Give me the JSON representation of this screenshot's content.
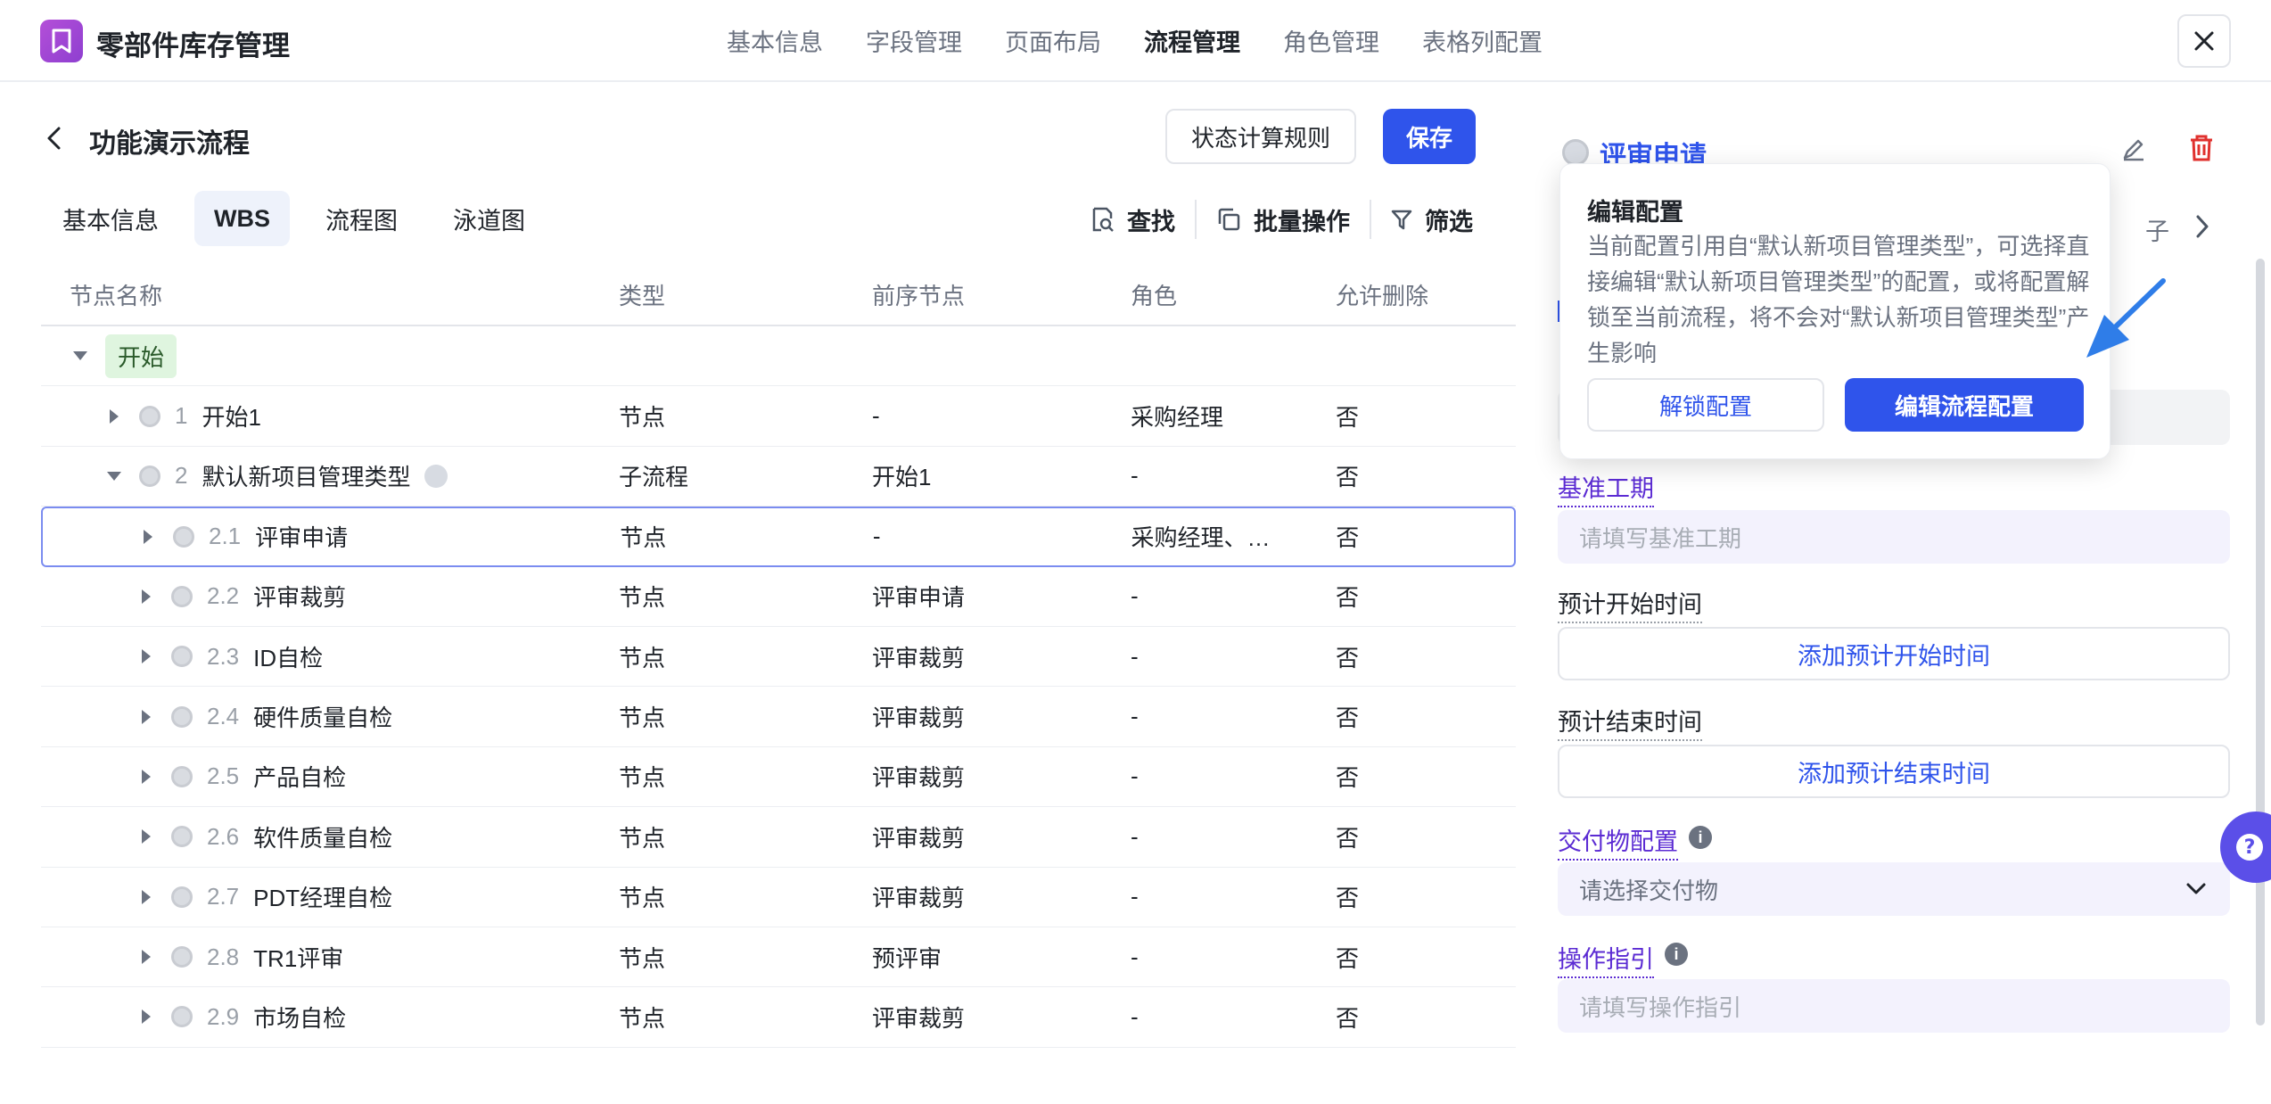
{
  "app": {
    "title": "零部件库存管理"
  },
  "top_tabs": [
    {
      "label": "基本信息",
      "active": false
    },
    {
      "label": "字段管理",
      "active": false
    },
    {
      "label": "页面布局",
      "active": false
    },
    {
      "label": "流程管理",
      "active": true
    },
    {
      "label": "角色管理",
      "active": false
    },
    {
      "label": "表格列配置",
      "active": false
    }
  ],
  "page": {
    "title": "功能演示流程",
    "rule_button": "状态计算规则",
    "save_button": "保存"
  },
  "sub_tabs": [
    {
      "label": "基本信息",
      "active": false
    },
    {
      "label": "WBS",
      "active": true
    },
    {
      "label": "流程图",
      "active": false
    },
    {
      "label": "泳道图",
      "active": false
    }
  ],
  "tools": {
    "find": "查找",
    "batch": "批量操作",
    "filter": "筛选"
  },
  "table": {
    "headers": {
      "name": "节点名称",
      "type": "类型",
      "pre": "前序节点",
      "role": "角色",
      "del": "允许删除"
    },
    "start_label": "开始",
    "rows": [
      {
        "num": "1",
        "name": "开始1",
        "type": "节点",
        "pre": "-",
        "role": "采购经理",
        "del": "否",
        "level": 1,
        "expanded": false
      },
      {
        "num": "2",
        "name": "默认新项目管理类型",
        "type": "子流程",
        "pre": "开始1",
        "role": "-",
        "del": "否",
        "level": 1,
        "expanded": true
      },
      {
        "num": "2.1",
        "name": "评审申请",
        "type": "节点",
        "pre": "-",
        "role": "采购经理、…",
        "del": "否",
        "level": 2,
        "expanded": false,
        "selected": true
      },
      {
        "num": "2.2",
        "name": "评审裁剪",
        "type": "节点",
        "pre": "评审申请",
        "role": "-",
        "del": "否",
        "level": 2,
        "expanded": false
      },
      {
        "num": "2.3",
        "name": "ID自检",
        "type": "节点",
        "pre": "评审裁剪",
        "role": "-",
        "del": "否",
        "level": 2,
        "expanded": false
      },
      {
        "num": "2.4",
        "name": "硬件质量自检",
        "type": "节点",
        "pre": "评审裁剪",
        "role": "-",
        "del": "否",
        "level": 2,
        "expanded": false
      },
      {
        "num": "2.5",
        "name": "产品自检",
        "type": "节点",
        "pre": "评审裁剪",
        "role": "-",
        "del": "否",
        "level": 2,
        "expanded": false
      },
      {
        "num": "2.6",
        "name": "软件质量自检",
        "type": "节点",
        "pre": "评审裁剪",
        "role": "-",
        "del": "否",
        "level": 2,
        "expanded": false
      },
      {
        "num": "2.7",
        "name": "PDT经理自检",
        "type": "节点",
        "pre": "评审裁剪",
        "role": "-",
        "del": "否",
        "level": 2,
        "expanded": false
      },
      {
        "num": "2.8",
        "name": "TR1评审",
        "type": "节点",
        "pre": "预评审",
        "role": "-",
        "del": "否",
        "level": 2,
        "expanded": false
      },
      {
        "num": "2.9",
        "name": "市场自检",
        "type": "节点",
        "pre": "评审裁剪",
        "role": "-",
        "del": "否",
        "level": 2,
        "expanded": false
      }
    ]
  },
  "right_panel": {
    "title": "评审申请",
    "sub_label": "子",
    "fields": {
      "duration_label": "基准工期",
      "duration_placeholder": "请填写基准工期",
      "start_label": "预计开始时间",
      "start_button": "添加预计开始时间",
      "end_label": "预计结束时间",
      "end_button": "添加预计结束时间",
      "deliverable_label": "交付物配置",
      "deliverable_placeholder": "请选择交付物",
      "guide_label": "操作指引",
      "guide_placeholder": "请填写操作指引"
    }
  },
  "popover": {
    "title": "编辑配置",
    "text": "当前配置引用自“默认新项目管理类型”，可选择直接编辑“默认新项目管理类型”的配置，或将配置解锁至当前流程，将不会对“默认新项目管理类型”产生影响",
    "unlock_button": "解锁配置",
    "edit_button": "编辑流程配置"
  },
  "colors": {
    "accent": "#2f54eb",
    "logo": "#a548d6",
    "purple_label": "#5b2bd3",
    "help": "#5b4fe8",
    "start_tag_bg": "#dff5df",
    "arrow": "#2f7de8"
  }
}
